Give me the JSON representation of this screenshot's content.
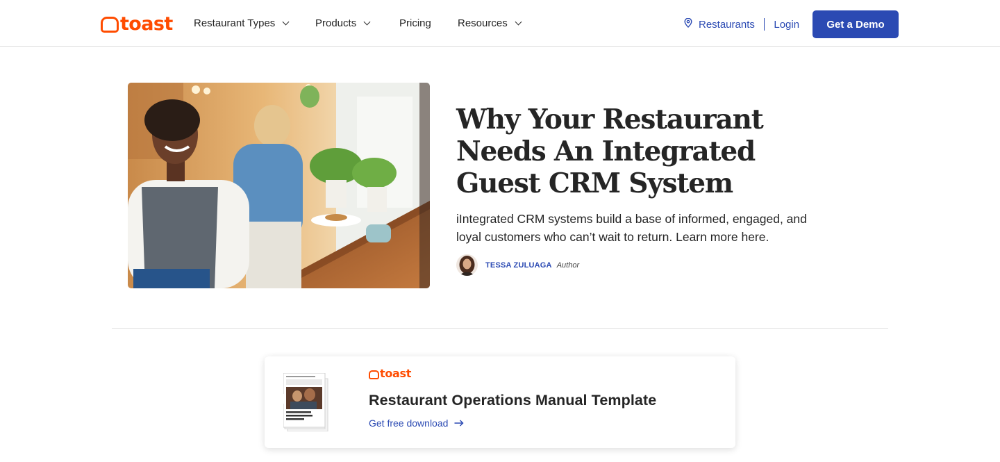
{
  "brand": {
    "logo_text": "toast",
    "accent": "#ff4c00",
    "link_color": "#2b4ab3"
  },
  "nav": {
    "restaurant_types": "Restaurant Types",
    "products": "Products",
    "pricing": "Pricing",
    "resources": "Resources"
  },
  "header_right": {
    "restaurants": "Restaurants",
    "login": "Login",
    "demo_button": "Get a Demo"
  },
  "article": {
    "title": "Why Your Restaurant Needs An Integrated Guest CRM System",
    "description": "iIntegrated CRM systems build a base of informed, engaged, and loyal customers who can’t wait to return. Learn more here.",
    "author_name": "TESSA ZULUAGA",
    "author_role": "Author"
  },
  "promo": {
    "logo_text": "toast",
    "title": "Restaurant Operations Manual Template",
    "cta": "Get free download",
    "thumb_caption": "Restaurant Operations Manual Template"
  },
  "icons": [
    "logo-icon",
    "chevron-down-icon",
    "location-pin-icon",
    "arrow-right-icon"
  ]
}
